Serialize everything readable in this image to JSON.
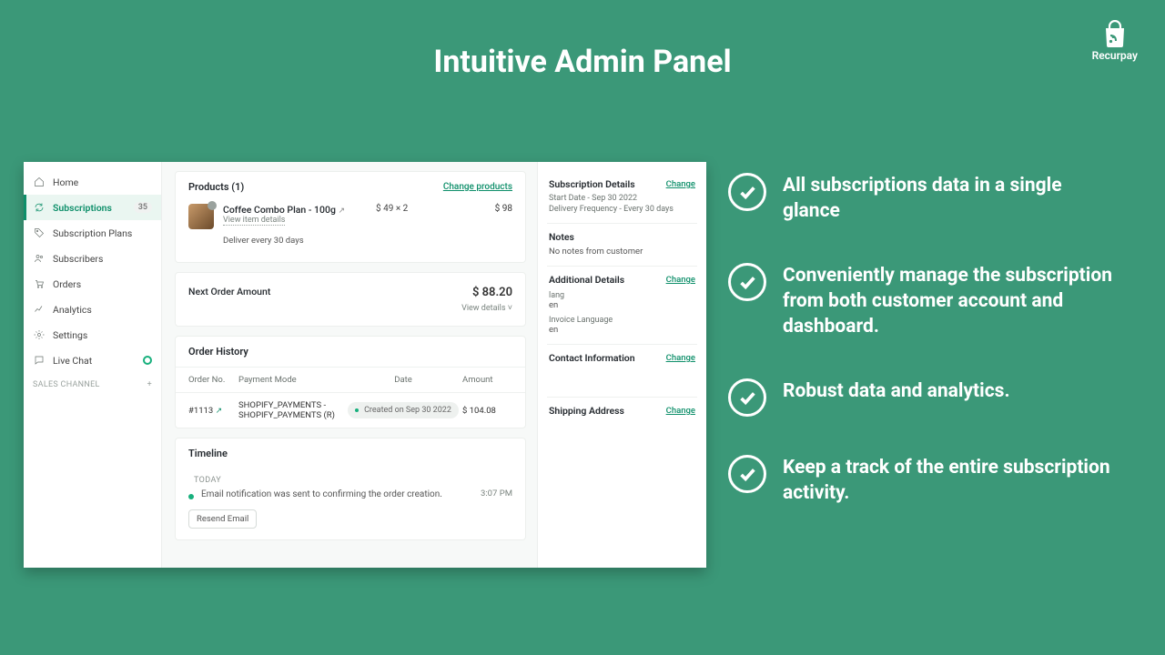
{
  "hero": {
    "title": "Intuitive Admin Panel"
  },
  "brand": {
    "name": "Recurpay"
  },
  "sidebar": {
    "items": [
      {
        "label": "Home"
      },
      {
        "label": "Subscriptions",
        "badge": "35"
      },
      {
        "label": "Subscription Plans"
      },
      {
        "label": "Subscribers"
      },
      {
        "label": "Orders"
      },
      {
        "label": "Analytics"
      },
      {
        "label": "Settings"
      },
      {
        "label": "Live Chat"
      }
    ],
    "section": "SALES CHANNEL"
  },
  "products": {
    "header": "Products (1)",
    "change": "Change products",
    "item": {
      "title": "Coffee Combo Plan - 100g",
      "view": "View item details",
      "deliver": "Deliver every 30 days",
      "price_each": "$ 49 × 2",
      "price_total": "$ 98"
    }
  },
  "nextOrder": {
    "label": "Next Order Amount",
    "amount": "$ 88.20",
    "viewDetails": "View details ˅"
  },
  "orderHistory": {
    "title": "Order History",
    "cols": {
      "orderNo": "Order No.",
      "mode": "Payment Mode",
      "date": "Date",
      "amount": "Amount"
    },
    "row": {
      "orderNo": "#1113",
      "mode": "SHOPIFY_PAYMENTS - SHOPIFY_PAYMENTS (R)",
      "dateChip": "Created on Sep 30 2022",
      "amount": "$ 104.08"
    }
  },
  "timeline": {
    "title": "Timeline",
    "today": "TODAY",
    "text": "Email notification was sent to                          confirming the order creation.",
    "time": "3:07 PM",
    "resend": "Resend Email"
  },
  "details": {
    "sub": {
      "title": "Subscription Details",
      "change": "Change",
      "start": "Start Date - Sep 30 2022",
      "freq": "Delivery Frequency - Every 30 days"
    },
    "notes": {
      "title": "Notes",
      "body": "No notes from customer"
    },
    "additional": {
      "title": "Additional Details",
      "change": "Change",
      "k1": "lang",
      "v1": "en",
      "k2": "Invoice Language",
      "v2": "en"
    },
    "contact": {
      "title": "Contact Information",
      "change": "Change"
    },
    "shipping": {
      "title": "Shipping Address",
      "change": "Change"
    }
  },
  "features": [
    "All subscriptions data in a single glance",
    "Conveniently manage the subscription from both customer account and dashboard.",
    "Robust data and analytics.",
    "Keep a track of the entire subscription activity."
  ]
}
